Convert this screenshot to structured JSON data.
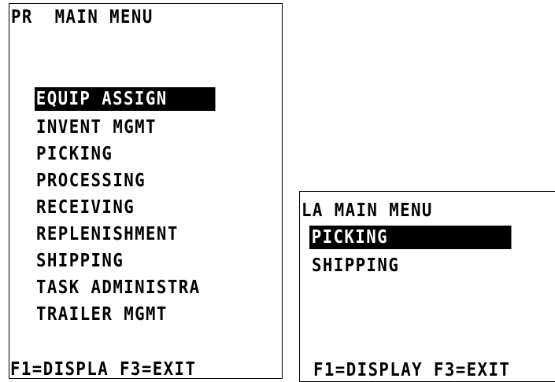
{
  "screens": [
    {
      "title": "PR  MAIN MENU",
      "menu_items": [
        {
          "label": "EQUIP ASSIGN",
          "selected": true
        },
        {
          "label": "INVENT MGMT",
          "selected": false
        },
        {
          "label": "PICKING",
          "selected": false
        },
        {
          "label": "PROCESSING",
          "selected": false
        },
        {
          "label": "RECEIVING",
          "selected": false
        },
        {
          "label": "REPLENISHMENT",
          "selected": false
        },
        {
          "label": "SHIPPING",
          "selected": false
        },
        {
          "label": "TASK ADMINISTRA",
          "selected": false
        },
        {
          "label": "TRAILER MGMT",
          "selected": false
        }
      ],
      "footer": "F1=DISPLA F3=EXIT"
    },
    {
      "title": "LA MAIN MENU",
      "menu_items": [
        {
          "label": "PICKING",
          "selected": true
        },
        {
          "label": "SHIPPING",
          "selected": false
        }
      ],
      "footer": "F1=DISPLAY F3=EXIT"
    }
  ],
  "colors": {
    "background": "#ffffff",
    "text": "#000000",
    "highlight_background": "#000000",
    "highlight_text": "#ffffff"
  }
}
